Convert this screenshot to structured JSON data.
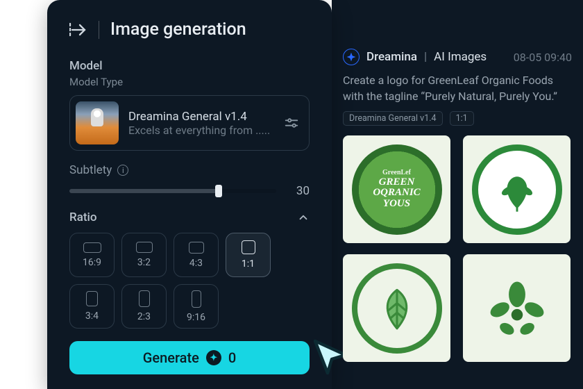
{
  "panel": {
    "title": "Image generation",
    "model_section_label": "Model",
    "model_type_label": "Model Type",
    "model": {
      "name": "Dreamina General v1.4",
      "desc": "Excels at everything from ....."
    },
    "subtlety_label": "Subtlety",
    "subtlety_value": "30",
    "ratio_label": "Ratio",
    "ratios": [
      "16:9",
      "3:2",
      "4:3",
      "1:1",
      "3:4",
      "2:3",
      "9:16"
    ],
    "ratio_selected_index": 3,
    "generate_label": "Generate",
    "generate_credits": "0"
  },
  "feed": {
    "author": "Dreamina",
    "category": "AI Images",
    "timestamp": "08-05  09:40",
    "prompt": "Create a logo for GreenLeaf Organic Foods with the tagline “Purely Natural, Purely You.”",
    "tags": [
      "Dreamina General v1.4",
      "1:1"
    ]
  },
  "ratio_shapes": [
    {
      "w": 26,
      "h": 15
    },
    {
      "w": 24,
      "h": 16
    },
    {
      "w": 22,
      "h": 17
    },
    {
      "w": 20,
      "h": 20
    },
    {
      "w": 17,
      "h": 22
    },
    {
      "w": 16,
      "h": 24
    },
    {
      "w": 14,
      "h": 25
    }
  ]
}
